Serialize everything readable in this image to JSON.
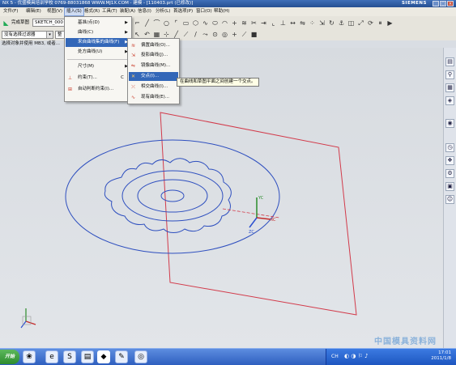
{
  "window": {
    "title": "NX 5 - 优盛模具培训学校  0769-88031868  WWW.MJ1X.COM - 建模 - [110403.prt (已修改)]",
    "brand": "SIEMENS",
    "controls": [
      "_",
      "□",
      "×"
    ]
  },
  "menubar": {
    "items": [
      "文件(F)",
      "编辑(E)",
      "视图(V)",
      "插入(S)",
      "格式(R)",
      "工具(T)",
      "装配(A)",
      "信息(I)",
      "分析(L)",
      "首选项(P)",
      "窗口(O)",
      "帮助(H)"
    ]
  },
  "toolbar": {
    "finish_sketch": "完成草图",
    "sketch_name": "SKETCH_000",
    "filter_label": "没有选择过滤器",
    "snap_label": "整"
  },
  "status": {
    "prompt": "选择对象并使用 MB3, 或者..."
  },
  "insert_menu": {
    "items": [
      {
        "label": "基准/点(D)",
        "shortcut": "",
        "submenu": true,
        "icon": ""
      },
      {
        "label": "曲线(C)",
        "shortcut": "",
        "submenu": true,
        "icon": ""
      },
      {
        "label": "来自曲线集的曲线(F)",
        "shortcut": "",
        "submenu": true,
        "icon": "",
        "highlight": true
      },
      {
        "label": "处方曲线(U)",
        "shortcut": "",
        "submenu": true,
        "icon": ""
      },
      {
        "label": "尺寸(M)",
        "shortcut": "",
        "submenu": true,
        "icon": ""
      },
      {
        "label": "约束(T)...",
        "shortcut": "C",
        "submenu": false,
        "icon": "constraint-icon"
      },
      {
        "label": "自动判断约束(I)...",
        "shortcut": "",
        "submenu": false,
        "icon": "infer-constraint-icon"
      }
    ]
  },
  "curve_submenu": {
    "items": [
      {
        "label": "偏置曲线(O)...",
        "icon": "offset-curve-icon"
      },
      {
        "label": "投影曲线(J)...",
        "icon": "project-curve-icon"
      },
      {
        "label": "镜像曲线(M)...",
        "icon": "mirror-curve-icon"
      },
      {
        "label": "交点(I)...",
        "icon": "intersect-point-icon",
        "highlight": true
      },
      {
        "label": "相交曲线(I)...",
        "icon": "intersect-curve-icon"
      },
      {
        "label": "现有曲线(E)...",
        "icon": "existing-curve-icon"
      }
    ]
  },
  "tooltip": {
    "text": "在曲线和草图平面之间创建一个交点。"
  },
  "csys": {
    "x": "XC",
    "y": "YC",
    "z": "ZC"
  },
  "taskbar": {
    "start": "开始",
    "clock_time": "17:01",
    "clock_date": "2011/1/8"
  },
  "watermark": "中国模具资料网",
  "colors": {
    "sketch_plane": "#d23a4a",
    "sketch_curves": "#2e4fbf",
    "highlight": "#3367b8"
  }
}
